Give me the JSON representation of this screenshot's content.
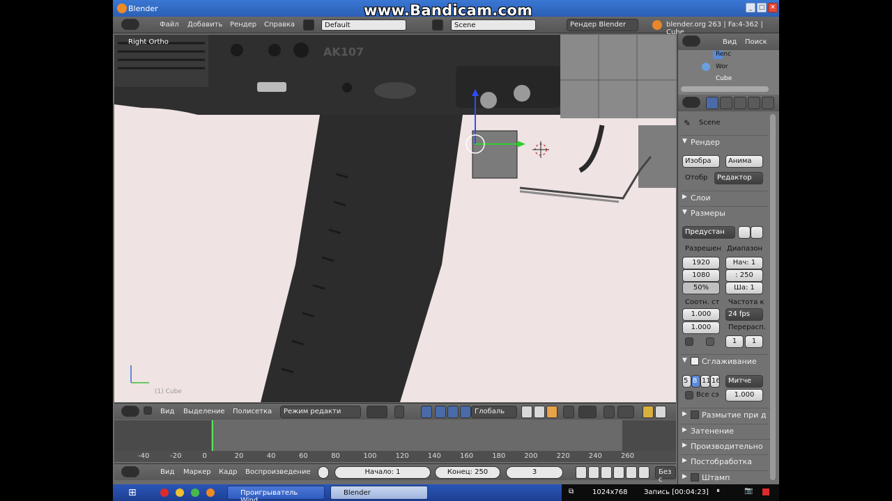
{
  "watermark": "www.Bandicam.com",
  "window": {
    "title": "Blender",
    "controls": [
      "_",
      "□",
      "✕"
    ]
  },
  "info_header": {
    "menus": [
      "Файл",
      "Добавить",
      "Рендер",
      "Справка"
    ],
    "layout_name": "Default",
    "scene_name": "Scene",
    "render_engine": "Рендер Blender",
    "status": "blender.org 263 | Fa:4-362 | Cube"
  },
  "viewport": {
    "view_label": "Right Ortho",
    "object_label": "(1) Cube",
    "engraving": "AK107"
  },
  "view3d_header": {
    "menus": [
      "Вид",
      "Выделение",
      "Полисетка"
    ],
    "mode": "Режим редакти",
    "orientation": "Глобаль"
  },
  "timeline": {
    "ticks": [
      "-40",
      "-20",
      "0",
      "20",
      "40",
      "60",
      "80",
      "100",
      "120",
      "140",
      "160",
      "180",
      "200",
      "220",
      "240",
      "260"
    ],
    "current_frame": 3
  },
  "timeline_header": {
    "menus": [
      "Вид",
      "Маркер",
      "Кадр",
      "Воспроизведение"
    ],
    "start": "Начало: 1",
    "end": "Конец: 250",
    "current": "3",
    "sync": "Без с"
  },
  "outliner": {
    "menus": [
      "Вид",
      "Поиск"
    ],
    "items": [
      "Renc",
      "Wor",
      "Cube"
    ]
  },
  "properties": {
    "context": "Scene",
    "panels": {
      "render": "Рендер",
      "render_btn": "Изобра",
      "anim_btn": "Анима",
      "display_label": "Отобр",
      "display_value": "Редактор",
      "layers": "Слои",
      "dimensions": "Размеры",
      "presets": "Предустан",
      "resolution_label": "Разрешен",
      "res_x": "1920",
      "res_y": "1080",
      "res_pct": "50%",
      "range_label": "Диапазон",
      "frame_start": "Нач: 1",
      "frame_end": ": 250",
      "frame_step": "Ша: 1",
      "aspect_label": "Соотн. ст",
      "aspect_x": "1.000",
      "aspect_y": "1.000",
      "fps_label": "Частота к",
      "fps": "24 fps",
      "remap_label": "Перерасп.",
      "remap_old": "1",
      "remap_new": "1",
      "aa": "Сглаживание",
      "aa_samples": [
        "5",
        "8",
        "11",
        "16"
      ],
      "aa_filter": "Митче",
      "full_sample": "Все сэ",
      "aa_size": "1.000",
      "motion_blur": "Размытие при д",
      "shading": "Затенение",
      "performance": "Производительно",
      "post": "Постобработка",
      "stamp": "Штамп"
    }
  },
  "taskbar": {
    "tasks": [
      "Проигрыватель Wind...",
      "Blender"
    ],
    "resolution": "1024x768",
    "recording": "Запись [00:04:23]"
  }
}
